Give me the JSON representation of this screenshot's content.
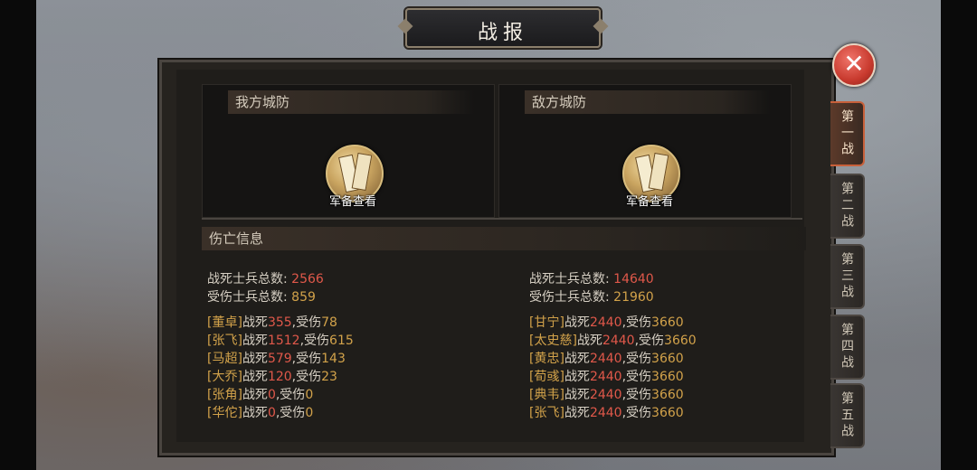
{
  "title": "战报",
  "close_symbol": "✕",
  "our_defense": {
    "header": "我方城防",
    "gear_label": "军备查看"
  },
  "enemy_defense": {
    "header": "敌方城防",
    "gear_label": "军备查看"
  },
  "casualty_header": "伤亡信息",
  "left": {
    "killed_label": "战死士兵总数:",
    "killed_total": "2566",
    "wounded_label": "受伤士兵总数:",
    "wounded_total": "859",
    "generals": [
      {
        "name": "[董卓]",
        "killed": "355",
        "wounded": "78"
      },
      {
        "name": "[张飞]",
        "killed": "1512",
        "wounded": "615"
      },
      {
        "name": "[马超]",
        "killed": "579",
        "wounded": "143"
      },
      {
        "name": "[大乔]",
        "killed": "120",
        "wounded": "23"
      },
      {
        "name": "[张角]",
        "killed": "0",
        "wounded": "0"
      },
      {
        "name": "[华佗]",
        "killed": "0",
        "wounded": "0"
      }
    ]
  },
  "right": {
    "killed_label": "战死士兵总数:",
    "killed_total": "14640",
    "wounded_label": "受伤士兵总数:",
    "wounded_total": "21960",
    "generals": [
      {
        "name": "[甘宁]",
        "killed": "2440",
        "wounded": "3660"
      },
      {
        "name": "[太史慈]",
        "killed": "2440",
        "wounded": "3660"
      },
      {
        "name": "[黄忠]",
        "killed": "2440",
        "wounded": "3660"
      },
      {
        "name": "[荀彧]",
        "killed": "2440",
        "wounded": "3660"
      },
      {
        "name": "[典韦]",
        "killed": "2440",
        "wounded": "3660"
      },
      {
        "name": "[张飞]",
        "killed": "2440",
        "wounded": "3660"
      }
    ]
  },
  "labels": {
    "killed": "战死",
    "wounded": ",受伤"
  },
  "tabs": [
    {
      "label": "第一战",
      "active": true
    },
    {
      "label": "第二战",
      "active": false
    },
    {
      "label": "第三战",
      "active": false
    },
    {
      "label": "第四战",
      "active": false
    },
    {
      "label": "第五战",
      "active": false
    }
  ],
  "colors": {
    "accent_red": "#e0584a",
    "name_gold": "#d2a24a",
    "tab_active": "#c8603a"
  }
}
